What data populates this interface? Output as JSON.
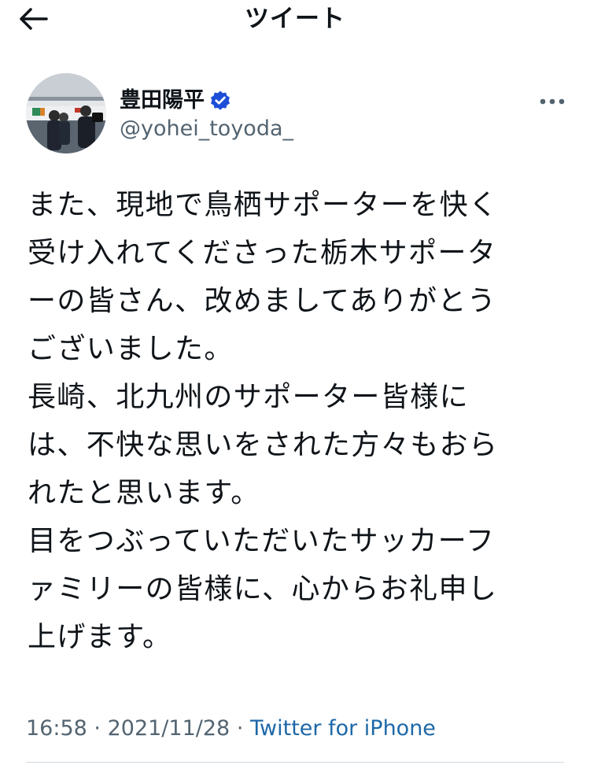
{
  "header": {
    "title": "ツイート",
    "back_icon": "arrow-left-icon"
  },
  "author": {
    "name": "豊田陽平",
    "handle": "@yohei_toyoda_",
    "verified_icon": "verified-badge-icon",
    "verified_color": "#1d4ed8"
  },
  "tweet": {
    "lines": [
      "また、現地で鳥栖サポーターを快く",
      "受け入れてくださった栃木サポータ",
      "ーの皆さん、改めましてありがとう",
      "ございました。",
      "長崎、北九州のサポーター皆様に",
      "は、不快な思いをされた方々もおら",
      "れたと思います。",
      "目をつぶっていただいたサッカーフ",
      "ァミリーの皆様に、心からお礼申し",
      "上げます。"
    ],
    "time": "16:58",
    "separator": "·",
    "date": "2021/11/28",
    "source": "Twitter for iPhone"
  },
  "colors": {
    "text": "#0f1419",
    "secondary": "#536471",
    "link": "#1d68a8",
    "divider": "#cfd9de"
  }
}
